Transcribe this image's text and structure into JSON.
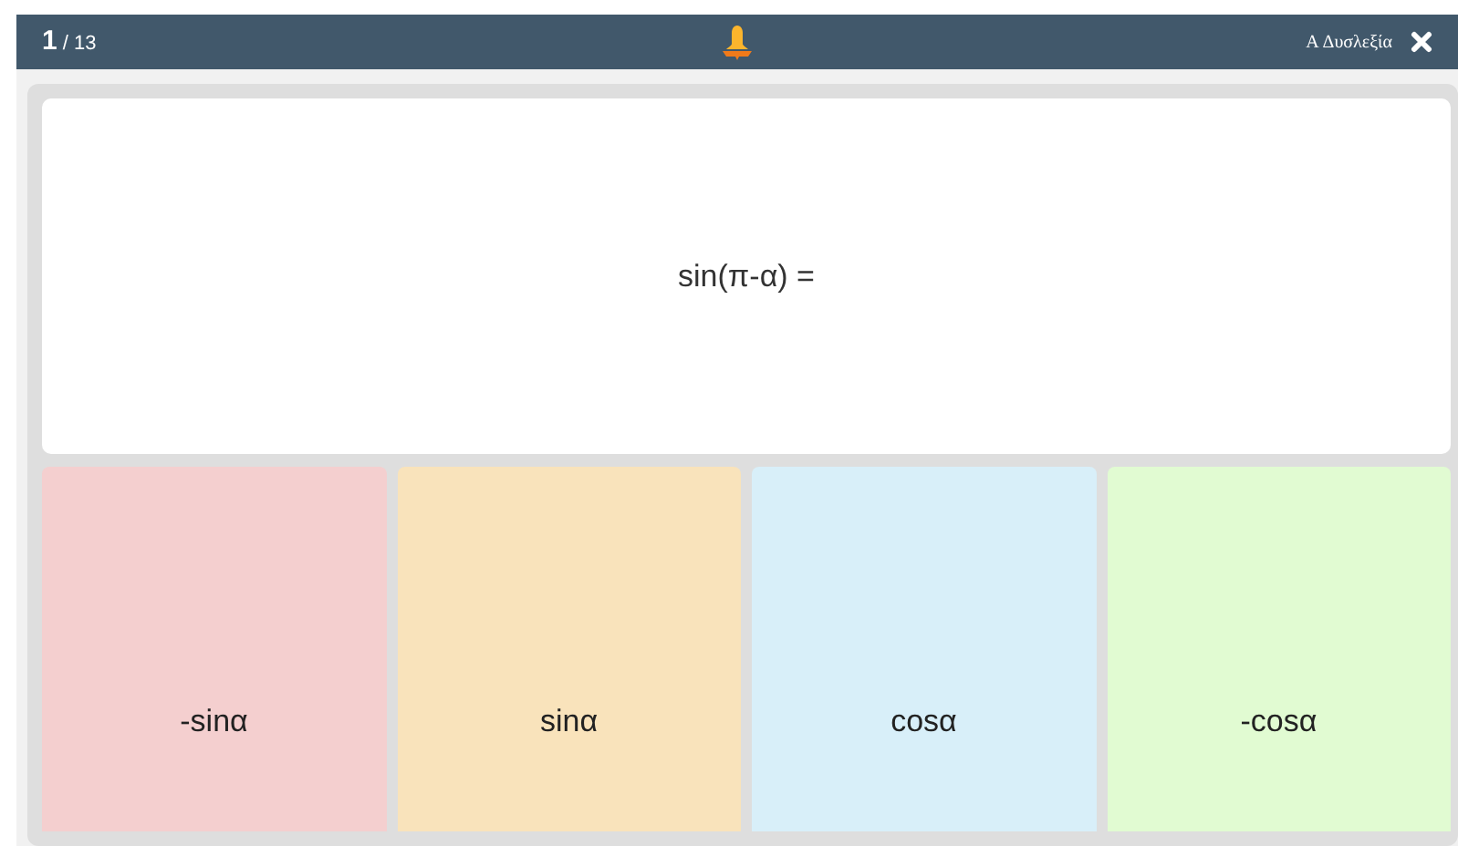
{
  "header": {
    "current": "1",
    "total": "/ 13",
    "dyslexia_label": "A Δυσλεξία"
  },
  "question": {
    "text": "sin(π-α) ="
  },
  "answers": [
    {
      "text": "-sinα",
      "color": "#f4cfcf"
    },
    {
      "text": "sinα",
      "color": "#f9e3bb"
    },
    {
      "text": "cosα",
      "color": "#d8eff9"
    },
    {
      "text": "-cosα",
      "color": "#e1fbd2"
    }
  ]
}
